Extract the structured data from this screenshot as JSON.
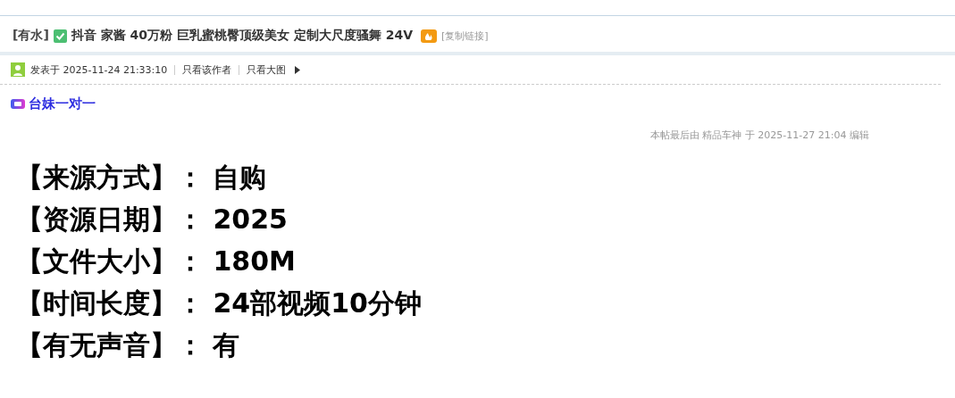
{
  "thread": {
    "category": "[有水]",
    "verified": true,
    "title": "抖音 家酱 40万粉 巨乳蜜桃臀顶级美女 定制大尺度骚舞 24V",
    "hot": true,
    "copy_link": "[复制链接]"
  },
  "post_meta": {
    "posted": "发表于 2025-11-24 21:33:10",
    "links": [
      "只看该作者",
      "只看大图"
    ]
  },
  "ad_link": "台妹一对一",
  "edit_note": "本帖最后由 精品车神 于 2025-11-27 21:04 编辑",
  "content_lines": [
    {
      "label": "【来源方式】：",
      "value": "自购"
    },
    {
      "label": "【资源日期】：",
      "value": "2025"
    },
    {
      "label": "【文件大小】：",
      "value": "180M"
    },
    {
      "label": "【时间长度】：",
      "value": "24部视频10分钟"
    },
    {
      "label": "【有无声音】：",
      "value": "有"
    }
  ]
}
